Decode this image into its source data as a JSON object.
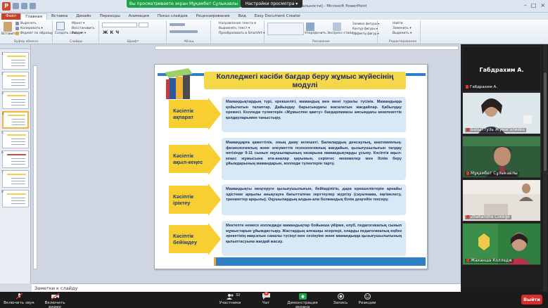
{
  "window": {
    "doc_title": "Бұлыбас ю. [Режим ограниченной функциональности] - Microsoft PowerPoint",
    "share_banner": "Вы просматриваете экран Мұқамбет Сұлыкавлы",
    "share_settings": "Настройки просмотра ▾"
  },
  "ribbon_tabs": [
    "Файл",
    "Главная",
    "Вставка",
    "Дизайн",
    "Переходы",
    "Анимация",
    "Показ слайдов",
    "Рецензирование",
    "Вид",
    "Easy Document Creator"
  ],
  "ribbon": {
    "paste": "Вставить",
    "cut": "Вырезать",
    "copy": "Копировать ▾",
    "format_painter": "Формат по образцу",
    "clipboard": "Буфер обмена",
    "new_slide": "Создать слайд ▾",
    "layout": "Макет ▾",
    "reset": "Восстановить",
    "section": "Раздел ▾",
    "slides": "Слайды",
    "font": "Шрифт",
    "paragraph": "Абзац",
    "text_direction": "Направление текста ▾",
    "align_text": "Выровнять текст ▾",
    "smartart": "Преобразовать в SmartArt ▾",
    "arrange": "Упорядочить",
    "quick_styles": "Экспресс-стили",
    "shape_fill": "Заливка фигуры ▾",
    "shape_outline": "Контур фигуры ▾",
    "shape_effects": "Эффекты фигур ▾",
    "drawing": "Рисование",
    "find": "Найти",
    "replace": "Заменить ▾",
    "select": "Выделить ▾",
    "editing": "Редактирование"
  },
  "slide_numbers": [
    "1",
    "2",
    "3",
    "4",
    "5",
    "6",
    "7",
    "8"
  ],
  "slide": {
    "title": "Колледжегі кәсіби бағдар беру жұмыс жүйесінің модулі",
    "rows": [
      {
        "label": "Кәсіптік ақпарат",
        "text": "Мамандықтардың түрі, ерекшелігі, мамандық мен мені туралы түсінік. Мамандыққа қойылатын талаптар. Дайындау барысындағы жасалатын жағдайлар. Қабылдау ережесі. Колледж түлектерін «Жұмыспен қамту» бағдарламасы аясындағы мемлекеттік қолдауларымен таныстыру."
      },
      {
        "label": "Кәсіптік ақыл-кеңес",
        "text": "Мамандарға қажеттілік, оның даму келешегі. Балалардың денсаулық, анатомиялық-физиологиялық және әлеуметтік психологиялық жағдайын, қызығушылығын талдау негізінде 9-11 сынып оқушыларының назарына мамандықтарды ұсыну. Кәсіптік ақыл-кеңес жұмысына ата-аналар қауымын, серіктес мекемелер мен білім беру ұйымдарының мамандарын, колледж түлектерін тарту."
      },
      {
        "label": "Кәсіптік іріктеу",
        "text": "Мамандықты меңгеруге қызығушылығын, бейімділігін, дара ерекшеліктерін арнайы әдістеме арқылы анықтауға бағытталған зерттеулер жүргізу (сауалнама, әңгімелесу, тренингтер арқылы). Оқушылардың алдын-ала болжандық білім деңгейін тексеру."
      },
      {
        "label": "Кәсіптік бейімдеу",
        "text": "Мектепте немесе колледжде мамандықтар бойынша үйірме, клуб, педагогикалық сынып жұмыстарын ұйымдастыру. Жастардың алғашқы әсерлері, оларды педагогикалық еңбек әрекетінің мақсатын саналы түсінуі мен сезінуіне және мамандыққа қызығушылығының қалыптасуына жағдай жасау."
      }
    ]
  },
  "notes_placeholder": "Заметки к слайду",
  "zoom": {
    "speaker_name": "Габдрахим А.",
    "speaker_label": "Габдрахим А.",
    "tiles": [
      {
        "name": "Бахыттуль Жумагалиева"
      },
      {
        "name": "Мұқамбет Сұлыкавлы"
      },
      {
        "name": "Zhahansha College"
      },
      {
        "name": "Жаханша Колледж"
      }
    ]
  },
  "toolbar": {
    "audio": "Включить звук",
    "video": "Включить видео",
    "participants": "Участники",
    "participants_count": "32",
    "chat": "Чат",
    "chat_badge": "1",
    "share": "Демонстрация экрана",
    "record": "Запись",
    "reactions": "Реакции",
    "leave": "Выйти"
  }
}
